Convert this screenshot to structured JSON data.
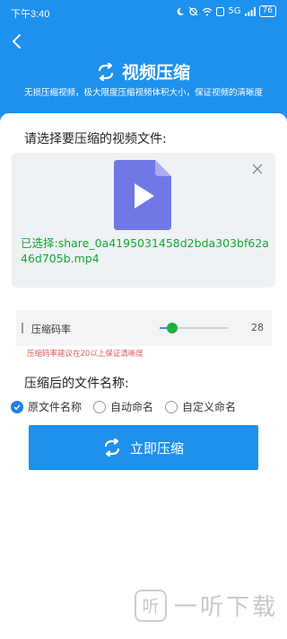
{
  "status_bar": {
    "time": "下午3:40",
    "icons": [
      "moon-icon",
      "alarm-off-icon",
      "wifi-icon",
      "sim-icon",
      "signal-icon"
    ],
    "network": "5G",
    "battery": "76"
  },
  "header": {
    "title": "视频压缩",
    "subtitle": "无损压缩视频，极大限度压缩视频体积大小，保证视频的清晰度"
  },
  "select_section": {
    "title": "请选择要压缩的视频文件:",
    "selected_file": "已选择:share_0a4195031458d2bda303bf62a46d705b.mp4"
  },
  "compression_rate": {
    "label": "压缩码率",
    "value": "28",
    "slider_fraction": 0.19,
    "hint": "压缩码率建议在20以上保证清晰度"
  },
  "filename_section": {
    "title": "压缩后的文件名称:",
    "options": [
      {
        "label": "原文件名称",
        "checked": true
      },
      {
        "label": "自动命名",
        "checked": false
      },
      {
        "label": "自定义命名",
        "checked": false
      }
    ]
  },
  "action_button": {
    "label": "立即压缩"
  },
  "watermark": {
    "logo": "听",
    "text": "一听下载"
  },
  "colors": {
    "primary": "#1e90ee",
    "success": "#14a832",
    "warning": "#e05a5a",
    "file_icon": "#6f78e4"
  }
}
